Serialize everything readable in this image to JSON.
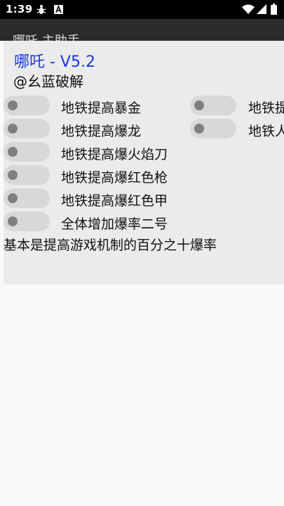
{
  "status_bar": {
    "time": "1:39",
    "icons": [
      "bug-icon",
      "a-box-icon",
      "wifi-icon",
      "signal-icon",
      "battery-icon"
    ]
  },
  "app_bar": {
    "title": "哪吒 主助手"
  },
  "panel": {
    "title": "哪吒 - V5.2",
    "author": "@幺蓝破解",
    "switches_left": [
      {
        "label": "地铁提高暴金",
        "on": false
      },
      {
        "label": "地铁提高爆龙",
        "on": false
      },
      {
        "label": "地铁提高爆火焰刀",
        "on": false
      },
      {
        "label": "地铁提高爆红色枪",
        "on": false
      },
      {
        "label": "地铁提高爆红色甲",
        "on": false
      },
      {
        "label": "全体增加爆率二号",
        "on": false
      }
    ],
    "switches_right": [
      {
        "label": "地铁提",
        "on": false
      },
      {
        "label": "地铁人",
        "on": false
      }
    ],
    "footer": "基本是提高游戏机制的百分之十爆率"
  },
  "colors": {
    "title_blue": "#1736e6",
    "panel_bg": "#ebebeb",
    "switch_track": "#d8d8d8",
    "switch_thumb": "#7f7f7f"
  }
}
